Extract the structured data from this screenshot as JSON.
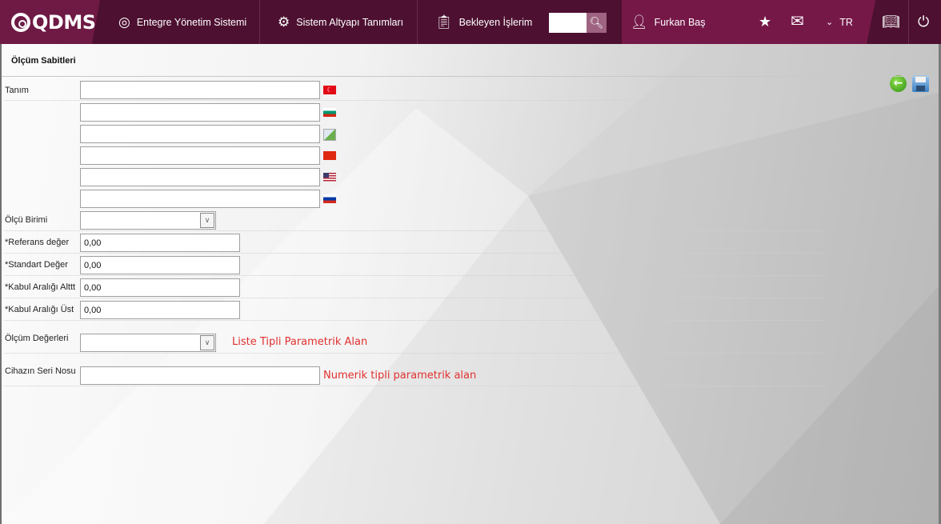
{
  "header": {
    "logo": "QDMS",
    "nav": [
      {
        "label": "Entegre Yönetim Sistemi",
        "icon": "qdms-q-icon"
      },
      {
        "label": "Sistem Altyapı Tanımları",
        "icon": "gear-icon"
      },
      {
        "label": "Bekleyen İşlerim",
        "icon": "clipboard-icon"
      }
    ],
    "search": {
      "value": "",
      "icon": "search-icon"
    },
    "user": "Furkan Baş",
    "language": "TR",
    "icons": [
      "user-icon",
      "star-icon",
      "mail-icon",
      "chevron-down-icon",
      "manual-book-icon",
      "power-icon"
    ]
  },
  "page": {
    "title": "Ölçüm Sabitleri",
    "toolbar": {
      "back_icon": "back-arrow-icon",
      "save_icon": "save-icon"
    },
    "form": {
      "tanim_label": "Tanım",
      "tanim_values": [
        "",
        "",
        "",
        "",
        "",
        ""
      ],
      "tanim_flags": [
        "tr",
        "bg",
        "broken-image",
        "cn",
        "us",
        "ru"
      ],
      "olcu_birimi_label": "Ölçü Birimi",
      "olcu_birimi_value": "",
      "referans_label": "*Referans değer",
      "referans_value": "0,00",
      "standart_label": "*Standart Değer",
      "standart_value": "0,00",
      "alt_label": "*Kabul Aralığı Alttt",
      "alt_value": "0,00",
      "ust_label": "*Kabul Aralığı Üst",
      "ust_value": "0,00",
      "olcum_degerleri_label": "Ölçüm Değerleri",
      "olcum_degerleri_value": "",
      "olcum_degerleri_note": "Liste Tipli Parametrik Alan",
      "seri_label": "Cihazın Seri Nosu",
      "seri_value": "",
      "seri_note": "Numerik tipli parametrik alan"
    }
  },
  "colors": {
    "header_dark": "#4d1030",
    "header_accent": "#751848",
    "note_red": "#e0302f"
  }
}
